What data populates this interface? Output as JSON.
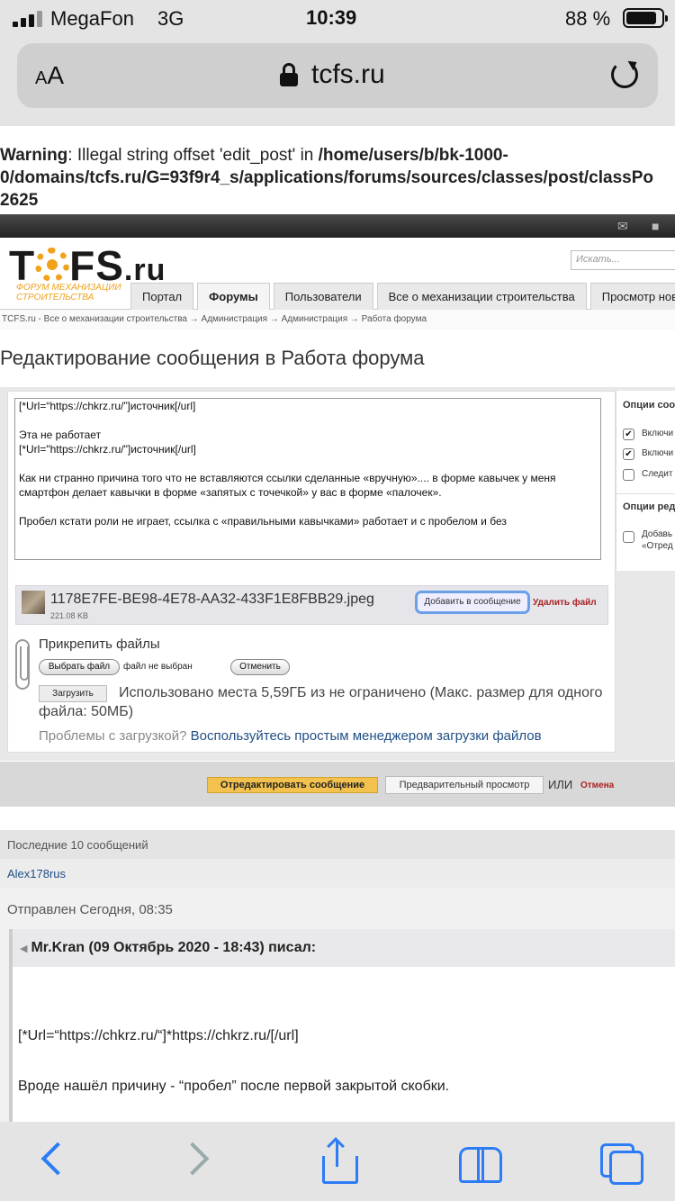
{
  "status_bar": {
    "carrier": "MegaFon",
    "network": "3G",
    "time": "10:39",
    "battery": "88 %",
    "battery_level": 0.88
  },
  "browser": {
    "text_size_label": "AA",
    "domain": "tcfs.ru",
    "icons": [
      "lock-icon",
      "reload-icon"
    ]
  },
  "warning": {
    "label": "Warning",
    "message": ": Illegal string offset 'edit_post' in ",
    "path_line1": "/home/users/b/bk-1000-",
    "path_line2": "0/domains/tcfs.ru/G=93f9r4_s/applications/forums/sources/classes/post/classPo",
    "line": "2625"
  },
  "site": {
    "logo": "TCFS",
    "logo_suffix": ".ru",
    "tagline": "ФОРУМ МЕХАНИЗАЦИИ СТРОИТЕЛЬСТВА",
    "search_placeholder": "Искать...",
    "tabs": [
      "Портал",
      "Форумы",
      "Пользователи",
      "Все о механизации строительства",
      "Просмотр нов"
    ]
  },
  "breadcrumb": "TCFS.ru - Все о механизации строительства → Администрация → Администрация → Работа форума",
  "page_title": "Редактирование сообщения в Работа форума",
  "editor": {
    "lines": [
      "[*Url=“https://chkrz.ru/”]источник[/url]",
      "",
      "Эта не работает",
      "[*Url=\"https://chkrz.ru/\"]источник[/url]",
      "",
      "Как ни странно причина того что не вставляются ссылки сделанные «вручную».... в форме кавычек у меня",
      "смартфон делает кавычки в форме «запятых с точечкой» у вас в форме «палочек».",
      "",
      "Пробел кстати роли не играет, ссылка с «правильными кавычками» работает и с пробелом и без"
    ]
  },
  "attachment": {
    "filename": "1178E7FE-BE98-4E78-AA32-433F1E8FBB29.jpeg",
    "size": "221.08 KB",
    "add_label": "Добавить в сообщение",
    "delete_label": "Удалить файл"
  },
  "upload": {
    "title": "Прикрепить файлы",
    "choose_label": "Выбрать файл",
    "no_file": "файл не выбран",
    "reset_label": "Отменить",
    "upload_label": "Загрузить",
    "quota": "Использовано места 5,59ГБ из не ограничено (Макс. размер для одного файла: 50МБ)",
    "problems": "Проблемы с загрузкой?",
    "simple_manager": "Воспользуйтесь простым менеджером загрузки файлов"
  },
  "options": {
    "heading1": "Опции соо",
    "items1": [
      {
        "label": "Включи",
        "checked": true
      },
      {
        "label": "Включи",
        "checked": true
      },
      {
        "label": "Следит",
        "checked": false
      }
    ],
    "heading2": "Опции ред",
    "item2_line1": "Добавь",
    "item2_line2": "«Отред"
  },
  "actions": {
    "submit": "Отредактировать сообщение",
    "preview": "Предварительный просмотр",
    "or": "ИЛИ",
    "cancel": "Отмена"
  },
  "recent": {
    "heading": "Последние 10 сообщений",
    "author": "Alex178rus",
    "sent": "Отправлен Сегодня, 08:35",
    "quote_header": "Mr.Kran (09 Октябрь 2020 - 18:43) писал:",
    "quote_line1": "[*Url=“https://chkrz.ru/“]*https://chkrz.ru/[/url]",
    "quote_line2": "Вроде нашёл причину - “пробел” после первой закрытой скобки."
  },
  "toolbar_icons": [
    "back-icon",
    "forward-icon",
    "share-icon",
    "bookmarks-icon",
    "tabs-icon"
  ],
  "colors": {
    "accent": "#2d7cf6",
    "brand": "#f0a21a",
    "submit": "#f2c14e",
    "danger": "#aa2222",
    "link": "#1f4f85"
  }
}
